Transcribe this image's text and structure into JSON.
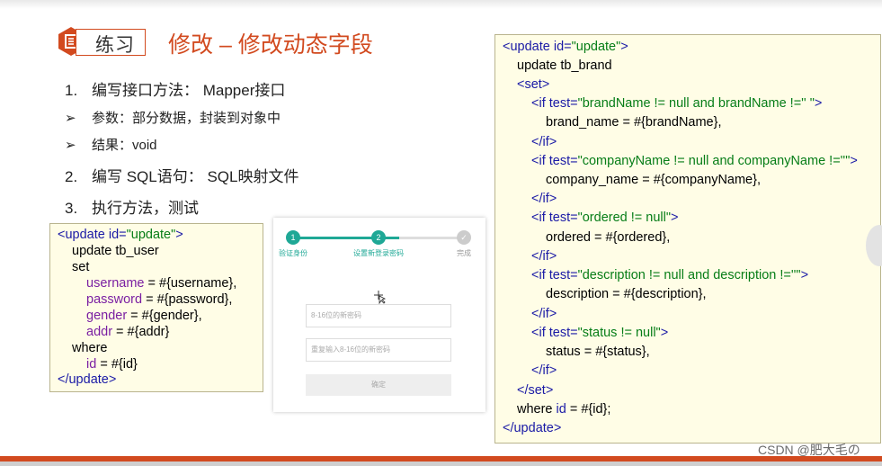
{
  "header": {
    "badge_label": "练习",
    "title": "修改 – 修改动态字段"
  },
  "list": [
    {
      "marker": "1.",
      "text": "编写接口方法： Mapper接口"
    },
    {
      "marker": "➢",
      "text": "参数：部分数据，封装到对象中"
    },
    {
      "marker": "➢",
      "text": "结果：void"
    },
    {
      "marker": "2.",
      "text": "编写 SQL语句： SQL映射文件"
    },
    {
      "marker": "3.",
      "text": "执行方法，测试"
    }
  ],
  "code_left": {
    "l1_open": "<update ",
    "l1_attr": "id=",
    "l1_val": "\"update\"",
    "l1_close": ">",
    "l2": "update tb_user",
    "l3": "set",
    "l4_a": "username",
    "l4_b": " = #{username},",
    "l5_a": "password",
    "l5_b": " = #{password},",
    "l6_a": "gender",
    "l6_b": " = #{gender},",
    "l7_a": "addr",
    "l7_b": " = #{addr}",
    "l8": "where",
    "l9_a": "id",
    "l9_b": " = #{id}",
    "l10": "</update>"
  },
  "code_right": {
    "l1_open": "<update ",
    "l1_attr": "id=",
    "l1_val": "\"update\"",
    "l1_close": ">",
    "l2": "update tb_brand",
    "l3": "<set>",
    "l4_open": "<if ",
    "l4_attr": "test=",
    "l4_val": "\"brandName != null and brandName !='' \"",
    "l4_close": ">",
    "l5": "brand_name = #{brandName},",
    "l6": "</if>",
    "l7_open": "<if ",
    "l7_attr": "test=",
    "l7_val": "\"companyName != null and companyName !=''\"",
    "l7_close": ">",
    "l8": "company_name = #{companyName},",
    "l9": "</if>",
    "l10_open": "<if ",
    "l10_attr": "test=",
    "l10_val": "\"ordered != null\"",
    "l10_close": ">",
    "l11": "ordered = #{ordered},",
    "l12": "</if>",
    "l13_open": "<if ",
    "l13_attr": "test=",
    "l13_val": "\"description != null and description !=''\"",
    "l13_close": ">",
    "l14": "description = #{description},",
    "l15": "</if>",
    "l16_open": "<if ",
    "l16_attr": "test=",
    "l16_val": "\"status != null\"",
    "l16_close": ">",
    "l17": "status = #{status},",
    "l18": "</if>",
    "l19": "</set>",
    "l20_a": "where ",
    "l20_b": "id",
    "l20_c": " = #{id};",
    "l21": "</update>"
  },
  "screenshot": {
    "step1_num": "1",
    "step2_num": "2",
    "step3_num": "✓",
    "step1_label": "验证身份",
    "step2_label": "设置新登录密码",
    "step3_label": "完成",
    "new_password_placeholder": "8-16位的新密码",
    "confirm_password_placeholder": "重复输入8-16位的新密码",
    "confirm_button": "确定"
  },
  "watermark": "CSDN @肥大毛の",
  "colors": {
    "accent": "#d24a1f",
    "teal": "#1fa896",
    "code_bg": "#fffde6"
  }
}
